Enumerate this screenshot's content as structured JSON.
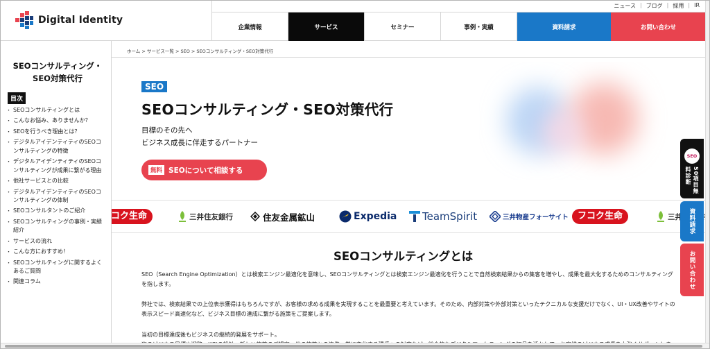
{
  "header": {
    "logo_text": "Digital Identity",
    "util_links": [
      "ニュース",
      "ブログ",
      "採用",
      "IR"
    ],
    "nav": [
      {
        "label": "企業情報",
        "style": "normal"
      },
      {
        "label": "サービス",
        "style": "active"
      },
      {
        "label": "セミナー",
        "style": "normal"
      },
      {
        "label": "事例・実績",
        "style": "normal"
      },
      {
        "label": "資料請求",
        "style": "blue"
      },
      {
        "label": "お問い合わせ",
        "style": "red"
      }
    ]
  },
  "breadcrumb": "ホーム > サービス一覧 > SEO > SEOコンサルティング・SEO対策代行",
  "sidebar": {
    "title_line1": "SEOコンサルティング・",
    "title_line2": "SEO対策代行",
    "toc_label": "目次",
    "toc": [
      "SEOコンサルティングとは",
      "こんなお悩み、ありませんか？",
      "SEOを行うべき理由とは？",
      "デジタルアイデンティティのSEOコンサルティングの特徴",
      "デジタルアイデンティティのSEOコンサルティングが成果に繋がる理由",
      "他社サービスとの比較",
      "デジタルアイデンティティのSEOコンサルティングの体制",
      "SEOコンサルタントのご紹介",
      "SEOコンサルティングの事例・実績紹介",
      "サービスの流れ",
      "こんな方におすすめ！",
      "SEOコンサルティングに関するよくあるご質問",
      "関連コラム"
    ]
  },
  "hero": {
    "tag": "SEO",
    "title": "SEOコンサルティング・SEO対策代行",
    "sub1": "目標のその先へ",
    "sub2": "ビジネス成長に伴走するパートナー",
    "cta_free": "無料",
    "cta_label": "SEOについて相談する"
  },
  "logos": {
    "fukoku": "フコク生命",
    "smbc": "三井住友銀行",
    "sumitomo": "住友金属鉱山",
    "expedia": "Expedia",
    "teamspirit": "TeamSpirit",
    "mitsui": "三井物産フォーサイト"
  },
  "section": {
    "title": "SEOコンサルティングとは",
    "p1": "SEO（Search Engine Optimization）とは検索エンジン最適化を意味し、SEOコンサルティングとは検索エンジン最適化を行うことで自然検索結果からの集客を増やし、成果を最大化するためのコンサルティングを指します。",
    "p2": "弊社では、検索結果での上位表示獲得はもちろんですが、お客様の求める成果を実現することを最重要と考えています。そのため、内部対策や外部対策といったテクニカルな支援だけでなく、UI・UX改善やサイトの表示スピード高速化など、ビジネス目標の達成に繋がる施策をご提案します。",
    "p3": "当初の目標達成後もビジネスの継続的発展をサポート。",
    "p4": "次のビジネス目標や戦略・KGIの設計、新しい施策のご提案、他の施策との連携、常に変化する環境への対応など、総合的なデジタルマーケティングの知見を活かして、お客様のビジネス成長を力強くサポートします。"
  },
  "floating": {
    "diag_badge": "SEO",
    "diag_label": "50項目無料診断",
    "docs_label": "資料請求",
    "contact_label": "お問い合わせ"
  }
}
